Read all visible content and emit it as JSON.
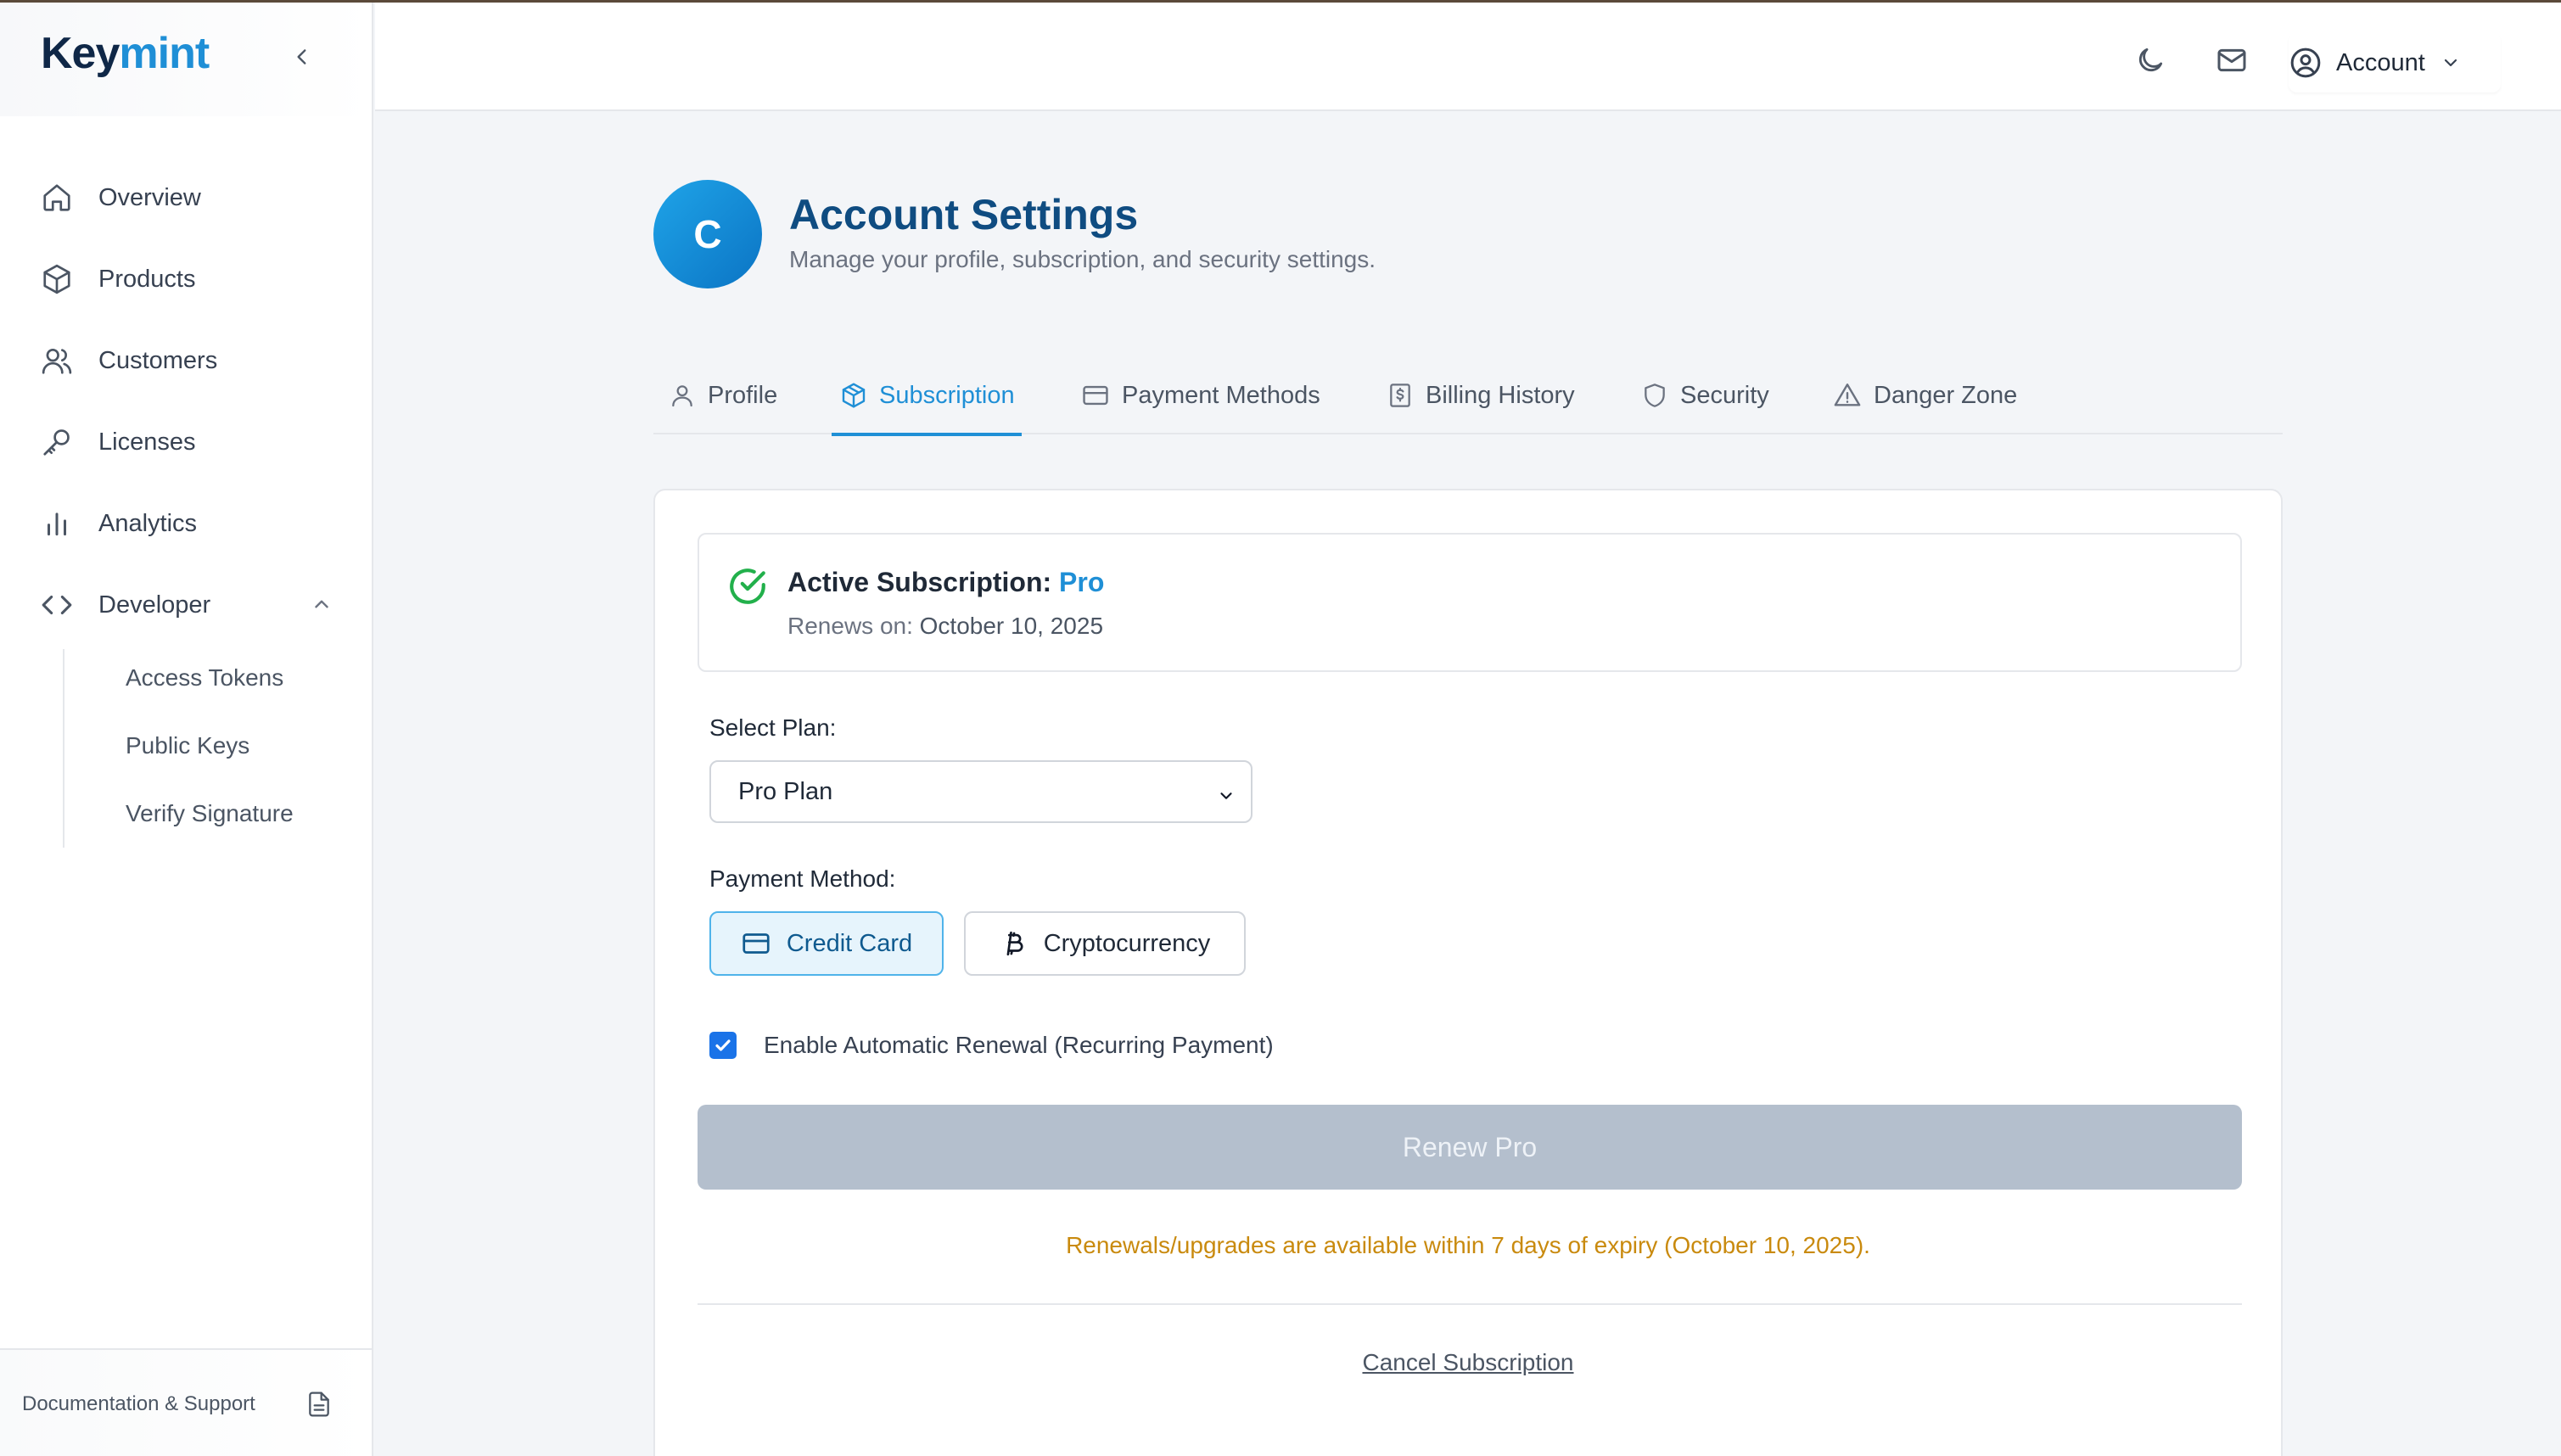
{
  "brand": {
    "prefix": "Key",
    "accent": "mint"
  },
  "sidebar": {
    "items": [
      {
        "label": "Overview",
        "icon": "home-icon"
      },
      {
        "label": "Products",
        "icon": "box-icon"
      },
      {
        "label": "Customers",
        "icon": "users-icon"
      },
      {
        "label": "Licenses",
        "icon": "key-icon"
      },
      {
        "label": "Analytics",
        "icon": "bar-chart-icon"
      },
      {
        "label": "Developer",
        "icon": "code-icon",
        "expanded": true
      }
    ],
    "developer_subitems": [
      "Access Tokens",
      "Public Keys",
      "Verify Signature"
    ],
    "footer_link": "Documentation & Support"
  },
  "header": {
    "theme_icon": "moon-icon",
    "mail_icon": "mail-icon",
    "account_label": "Account"
  },
  "page": {
    "avatar_initial": "C",
    "title": "Account Settings",
    "subtitle": "Manage your profile, subscription, and security settings."
  },
  "tabs": [
    {
      "label": "Profile",
      "icon": "user-icon",
      "active": false
    },
    {
      "label": "Subscription",
      "icon": "package-icon",
      "active": true
    },
    {
      "label": "Payment Methods",
      "icon": "credit-card-icon",
      "active": false
    },
    {
      "label": "Billing History",
      "icon": "receipt-icon",
      "active": false
    },
    {
      "label": "Security",
      "icon": "shield-icon",
      "active": false
    },
    {
      "label": "Danger Zone",
      "icon": "warning-icon",
      "active": false
    }
  ],
  "subscription": {
    "status_prefix": "Active Subscription:",
    "plan_name": "Pro",
    "renews_prefix": "Renews on:",
    "renews_date": "October 10, 2025",
    "select_plan_label": "Select Plan:",
    "selected_plan": "Pro Plan",
    "payment_method_label": "Payment Method:",
    "payment_options": [
      {
        "label": "Credit Card",
        "selected": true
      },
      {
        "label": "Cryptocurrency",
        "selected": false
      }
    ],
    "auto_renew_label": "Enable Automatic Renewal (Recurring Payment)",
    "auto_renew_checked": true,
    "renew_button": "Renew Pro",
    "renew_notice": "Renewals/upgrades are available within 7 days of expiry (October 10, 2025).",
    "cancel_link": "Cancel Subscription"
  },
  "colors": {
    "accent": "#1f8fd6",
    "brand_dark": "#0f2747",
    "success": "#22b04b",
    "warning_text": "#c98a0e",
    "disabled_button": "#b4bfcd"
  }
}
